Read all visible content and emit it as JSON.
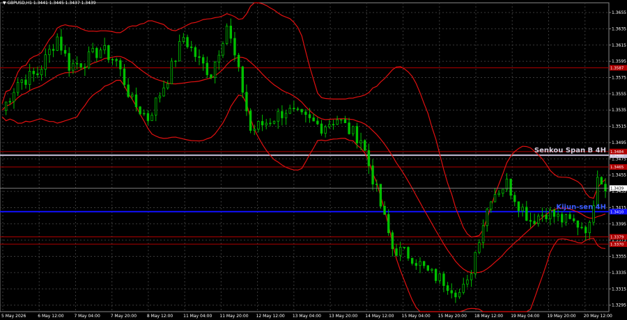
{
  "chart_window": {
    "header_text": "▼ GBPUSD,H1  1.3441 1.3445 1.3437 1.3439"
  },
  "chart_data": {
    "type": "candlestick",
    "symbol": "GBPUSD",
    "timeframe": "H1",
    "ohlc_last": {
      "open": 1.3441,
      "high": 1.3445,
      "low": 1.3437,
      "close": 1.3439
    },
    "ylim": [
      1.3287,
      1.3667
    ],
    "y_ticks": [
      "1.3655",
      "1.3635",
      "1.3615",
      "1.3595",
      "1.3575",
      "1.3555",
      "1.3535",
      "1.3515",
      "1.3495",
      "1.3475",
      "1.3455",
      "1.3435",
      "1.3415",
      "1.3395",
      "1.3375",
      "1.3355",
      "1.3335",
      "1.3315",
      "1.3295"
    ],
    "x_ticks": [
      "5 May 2026",
      "6 May 12:00",
      "7 May 04:00",
      "7 May 20:00",
      "8 May 12:00",
      "11 May 04:00",
      "11 May 20:00",
      "12 May 12:00",
      "13 May 04:00",
      "13 May 20:00",
      "14 May 12:00",
      "15 May 04:00",
      "15 May 20:00",
      "18 May 12:00",
      "19 May 04:00",
      "19 May 20:00",
      "20 May 12:00"
    ],
    "price_path": [
      [
        0,
        1.3535
      ],
      [
        4,
        1.357
      ],
      [
        9,
        1.358
      ],
      [
        14,
        1.3625
      ],
      [
        17,
        1.359
      ],
      [
        21,
        1.3595
      ],
      [
        25,
        1.361
      ],
      [
        29,
        1.3595
      ],
      [
        33,
        1.3545
      ],
      [
        37,
        1.3525
      ],
      [
        42,
        1.3575
      ],
      [
        46,
        1.3625
      ],
      [
        50,
        1.3595
      ],
      [
        53,
        1.358
      ],
      [
        57,
        1.364
      ],
      [
        61,
        1.356
      ],
      [
        63,
        1.351
      ],
      [
        67,
        1.352
      ],
      [
        72,
        1.3535
      ],
      [
        76,
        1.3525
      ],
      [
        81,
        1.3515
      ],
      [
        85,
        1.3525
      ],
      [
        88,
        1.351
      ],
      [
        91,
        1.35
      ],
      [
        95,
        1.3435
      ],
      [
        99,
        1.3365
      ],
      [
        104,
        1.3355
      ],
      [
        108,
        1.3335
      ],
      [
        112,
        1.3325
      ],
      [
        116,
        1.331
      ],
      [
        118,
        1.332
      ],
      [
        121,
        1.338
      ],
      [
        124,
        1.343
      ],
      [
        128,
        1.3445
      ],
      [
        131,
        1.342
      ],
      [
        134,
        1.34
      ],
      [
        138,
        1.341
      ],
      [
        142,
        1.34
      ],
      [
        146,
        1.3395
      ],
      [
        149,
        1.339
      ],
      [
        151,
        1.346
      ],
      [
        153,
        1.3439
      ]
    ],
    "levels": [
      {
        "name": "Senkou Span B 4H",
        "price": 1.34795,
        "color": "#C8C0D8",
        "label": "Senkou Span B 4H",
        "axis_label": "1.3480"
      },
      {
        "name": "Kijun-sen 4H",
        "price": 1.341,
        "color": "#1010FF",
        "label": "Kijun-sen 4H",
        "axis_label": "1.3410"
      },
      {
        "name": "resistance-1",
        "price": 1.3587,
        "color": "#B00000",
        "axis_label": "1.3587"
      },
      {
        "name": "resistance-2",
        "price": 1.3484,
        "color": "#B00000",
        "axis_label": "1.3484"
      },
      {
        "name": "resistance-3",
        "price": 1.3465,
        "color": "#B00000",
        "axis_label": "1.3465"
      },
      {
        "name": "support-1",
        "price": 1.3379,
        "color": "#B00000",
        "axis_label": "1.3379"
      },
      {
        "name": "support-2",
        "price": 1.337,
        "color": "#B00000",
        "axis_label": "1.3370"
      }
    ],
    "current_price": {
      "value": 1.3439,
      "label": "1.3439"
    },
    "colors": {
      "bull": "#00C000",
      "bear": "#00C000",
      "bands": "#E01010",
      "grid": "#3A3A3A",
      "background": "#000000"
    }
  }
}
